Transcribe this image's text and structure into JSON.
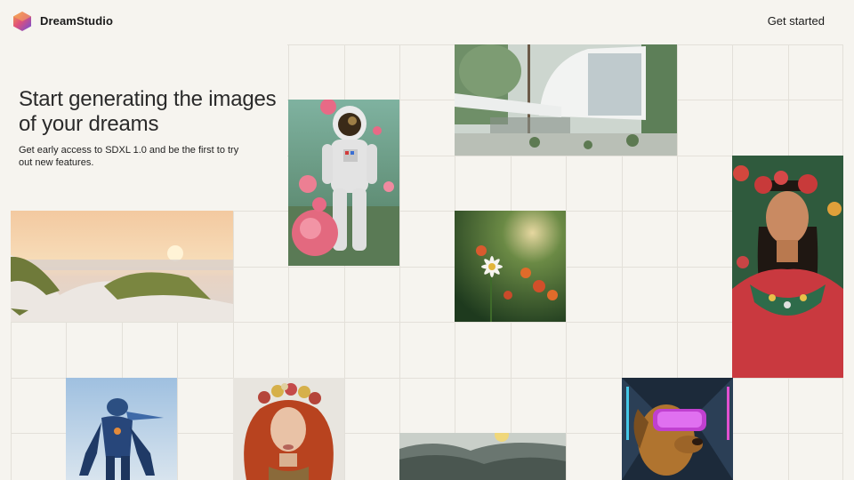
{
  "header": {
    "brand": "DreamStudio",
    "cta_label": "Get started",
    "logo_icon": "hexagon-gradient-logo-icon"
  },
  "hero": {
    "title": "Start generating the images of your dreams",
    "subtitle": "Get early access to SDXL 1.0 and be the first to try out new features."
  },
  "gallery": {
    "images": [
      {
        "name": "astronaut-roses-image"
      },
      {
        "name": "modern-house-image"
      },
      {
        "name": "frida-portrait-image"
      },
      {
        "name": "beach-dunes-sunset-image"
      },
      {
        "name": "daisy-flowers-image"
      },
      {
        "name": "blue-armored-robot-image"
      },
      {
        "name": "redhead-flower-crown-image"
      },
      {
        "name": "mountain-valley-image"
      },
      {
        "name": "vr-dog-image"
      }
    ]
  },
  "colors": {
    "background": "#f6f4ef",
    "grid_line": "#e3e0d9"
  }
}
